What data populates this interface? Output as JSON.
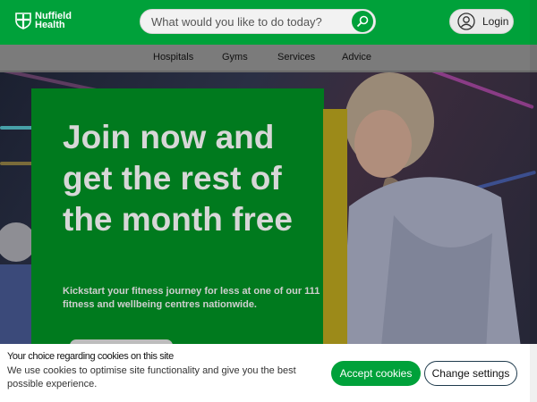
{
  "header": {
    "logo_line1": "Nuffield",
    "logo_line2": "Health",
    "search_placeholder": "What would you like to do today?",
    "login_label": "Login"
  },
  "nav": {
    "items": [
      {
        "label": "Hospitals"
      },
      {
        "label": "Gyms"
      },
      {
        "label": "Services"
      },
      {
        "label": "Advice"
      }
    ]
  },
  "hero": {
    "title": "Join now and get the rest of the month free",
    "subtitle": "Kickstart your fitness journey for less at one of our 111 fitness and wellbeing centres nationwide."
  },
  "cookie_banner": {
    "title": "Your choice regarding cookies on this site",
    "text": "We use cookies to optimise site functionality and give you the best possible experience.",
    "accept_label": "Accept cookies",
    "settings_label": "Change settings"
  },
  "colors": {
    "brand_green": "#00a13a",
    "promo_green": "#007a1e",
    "accent_gold": "#9c8a19"
  },
  "icons": [
    "nuffield-shield-logo",
    "search-icon",
    "user-icon"
  ]
}
